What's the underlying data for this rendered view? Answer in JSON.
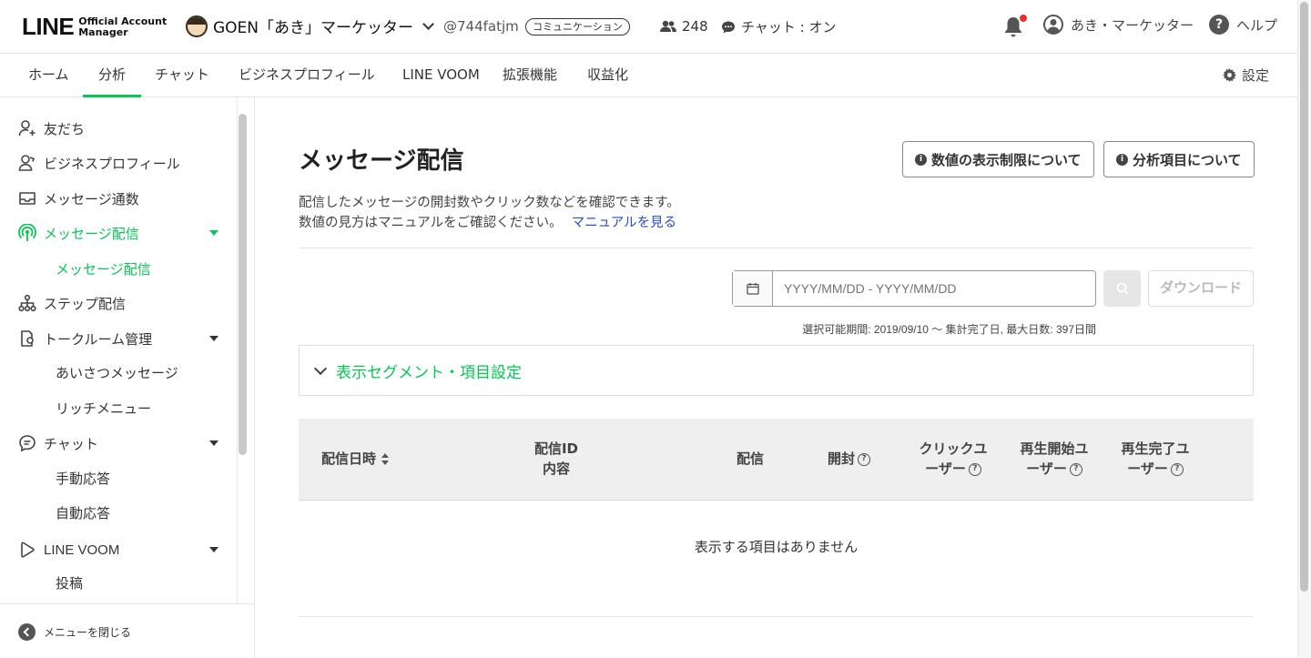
{
  "header": {
    "logo_main": "LINE",
    "logo_sub_line1": "Official Account",
    "logo_sub_line2": "Manager",
    "account_name": "GOEN「あき」マーケッター",
    "account_id": "@744fatjm",
    "category_badge": "コミュニケーション",
    "friends_count": "248",
    "chat_status": "チャット : オン",
    "user_name": "あき・マーケッター",
    "help_label": "ヘルプ"
  },
  "tabs": [
    {
      "label": "ホーム"
    },
    {
      "label": "分析",
      "active": true
    },
    {
      "label": "チャット"
    },
    {
      "label": "ビジネスプロフィール"
    },
    {
      "label": "LINE VOOM"
    },
    {
      "label": "拡張機能"
    },
    {
      "label": "収益化"
    }
  ],
  "settings_label": "設定",
  "sidebar": {
    "items": [
      {
        "label": "友だち",
        "icon": "person-add-icon"
      },
      {
        "label": "ビジネスプロフィール",
        "icon": "person-icon"
      },
      {
        "label": "メッセージ通数",
        "icon": "inbox-icon"
      },
      {
        "label": "メッセージ配信",
        "icon": "broadcast-icon",
        "active": true
      },
      {
        "label": "メッセージ配信",
        "sub": true,
        "active": true
      },
      {
        "label": "ステップ配信",
        "icon": "step-icon"
      },
      {
        "label": "トークルーム管理",
        "icon": "talkroom-icon"
      },
      {
        "label": "あいさつメッセージ",
        "sub": true
      },
      {
        "label": "リッチメニュー",
        "sub": true
      },
      {
        "label": "チャット",
        "icon": "chat-icon"
      },
      {
        "label": "手動応答",
        "sub": true
      },
      {
        "label": "自動応答",
        "sub": true
      },
      {
        "label": "LINE VOOM",
        "icon": "voom-icon"
      },
      {
        "label": "投稿",
        "sub": true
      }
    ],
    "close_menu_label": "メニューを閉じる"
  },
  "main": {
    "title": "メッセージ配信",
    "btn_display_limit": "数値の表示制限について",
    "btn_analysis_items": "分析項目について",
    "desc_line1": "配信したメッセージの開封数やクリック数などを確認できます。",
    "desc_line2": "数値の見方はマニュアルをご確認ください。",
    "manual_link": "マニュアルを見る",
    "date_placeholder": "YYYY/MM/DD - YYYY/MM/DD",
    "download_label": "ダウンロード",
    "period_note": "選択可能期間: 2019/09/10 〜 集計完了日, 最大日数: 397日間",
    "segment_label": "表示セグメント・項目設定",
    "columns": {
      "date": "配信日時",
      "id_line1": "配信ID",
      "id_line2": "内容",
      "delivered": "配信",
      "opened": "開封",
      "click_line1": "クリックユ",
      "click_line2": "ーザー",
      "play_start_line1": "再生開始ユ",
      "play_start_line2": "ーザー",
      "play_complete_line1": "再生完了ユ",
      "play_complete_line2": "ーザー"
    },
    "empty_text": "表示する項目はありません"
  },
  "colors": {
    "accent": "#06c755",
    "link": "#2b50c8",
    "notification_dot": "#e5322d"
  }
}
